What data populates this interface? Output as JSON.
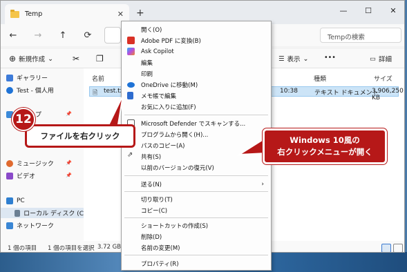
{
  "window": {
    "tab_title": "Temp",
    "tab_close": "✕",
    "new_tab": "+",
    "min": "—",
    "max": "☐",
    "close": "✕"
  },
  "nav": {
    "back": "←",
    "forward": "→",
    "up": "↑",
    "refresh": "⟳",
    "search_placeholder": "Tempの検索"
  },
  "toolbar": {
    "new_label": "新規作成",
    "view_label": "表示",
    "more": "•••",
    "details_label": "詳細"
  },
  "sidebar": {
    "items": [
      {
        "label": "ギャラリー"
      },
      {
        "label": "Test - 個人用"
      },
      {
        "label": "クトップ"
      },
      {
        "label": "ミュージック"
      },
      {
        "label": "ビデオ"
      },
      {
        "label": "PC"
      },
      {
        "label": "ローカル ディスク (C"
      },
      {
        "label": "ネットワーク"
      }
    ]
  },
  "files": {
    "headers": {
      "name": "名前",
      "type": "種類",
      "size": "サイズ"
    },
    "row": {
      "name": "test.txt",
      "time": "10:38",
      "type": "テキスト ドキュメント",
      "size": "3,906,250 KB"
    }
  },
  "status": {
    "count": "1 個の項目",
    "selected": "1 個の項目を選択",
    "size": "3.72 GB"
  },
  "menu": {
    "items": [
      {
        "label": "開く(O)",
        "icon": ""
      },
      {
        "label": "Adobe PDF に変換(B)",
        "icon": "adobe-pdf-icon"
      },
      {
        "label": "Ask Copilot",
        "icon": "copilot-icon"
      },
      {
        "label": "編集",
        "icon": ""
      },
      {
        "label": "印刷",
        "icon": ""
      },
      {
        "label": "OneDrive に移動(M)",
        "icon": "onedrive-icon"
      },
      {
        "label": "メモ帳で編集",
        "icon": "notepad-icon"
      },
      {
        "label": "お気に入りに追加(F)",
        "icon": ""
      },
      {
        "label": "Microsoft Defender でスキャンする...",
        "icon": "defender-icon"
      },
      {
        "label": "プログラムから開く(H)...",
        "icon": ""
      },
      {
        "label": "パスのコピー(A)",
        "icon": ""
      },
      {
        "label": "共有(S)",
        "icon": "share-icon"
      },
      {
        "label": "以前のバージョンの復元(V)",
        "icon": ""
      },
      {
        "label": "送る(N)",
        "icon": "",
        "submenu": true
      },
      {
        "label": "切り取り(T)",
        "icon": ""
      },
      {
        "label": "コピー(C)",
        "icon": ""
      },
      {
        "label": "ショートカットの作成(S)",
        "icon": ""
      },
      {
        "label": "削除(D)",
        "icon": ""
      },
      {
        "label": "名前の変更(M)",
        "icon": ""
      },
      {
        "label": "プロパティ(R)",
        "icon": ""
      }
    ]
  },
  "annotations": {
    "step_number": "12",
    "step_label": "ファイルを右クリック",
    "note_line1": "Windows 10風の",
    "note_line2": "右クリックメニューが開く",
    "accent_color": "#b61818"
  }
}
